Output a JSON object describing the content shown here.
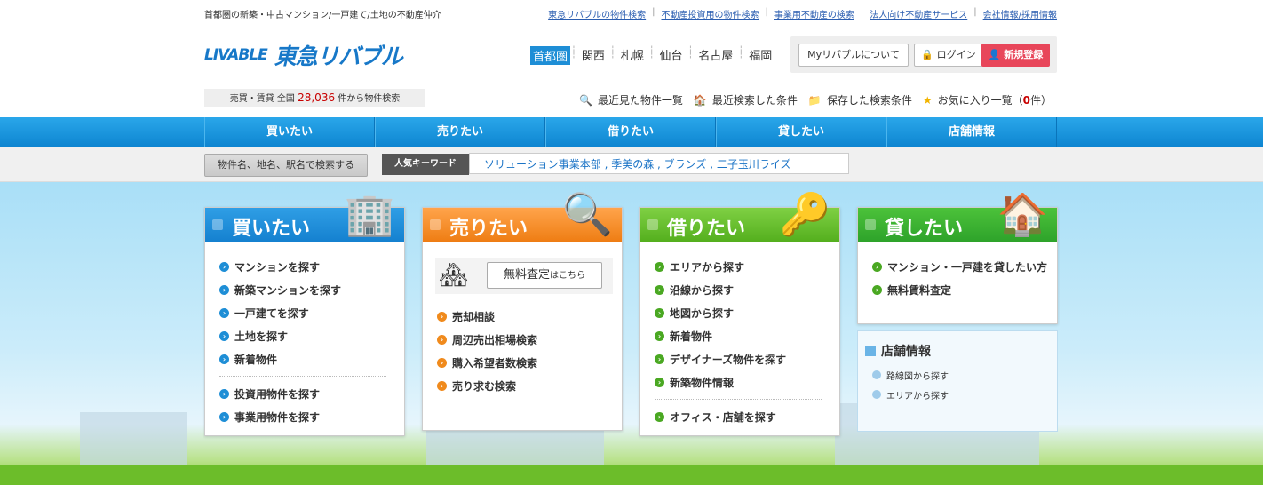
{
  "header": {
    "tagline": "首都圏の新築・中古マンション/一戸建て/土地の不動産仲介",
    "top_links": [
      "東急リバブルの物件検索",
      "不動産投資用の物件検索",
      "事業用不動産の検索",
      "法人向け不動産サービス",
      "会社情報/採用情報"
    ],
    "logo_mark": "LIVABLE",
    "logo_text": "東急リバブル",
    "regions": [
      "首都圏",
      "関西",
      "札幌",
      "仙台",
      "名古屋",
      "福岡"
    ],
    "active_region": "首都圏",
    "about_button": "Myリバブルについて",
    "login_button": "ログイン",
    "register_button": "新規登録"
  },
  "count": {
    "prefix": "売買・賃貸 全国",
    "number": "28,036",
    "suffix": "件から物件検索"
  },
  "quick_links": {
    "recent_viewed": "最近見た物件一覧",
    "recent_search": "最近検索した条件",
    "saved_search": "保存した検索条件",
    "favorites": "お気に入り一覧（",
    "favorites_count": "0",
    "favorites_suffix": "件）"
  },
  "nav": [
    "買いたい",
    "売りたい",
    "借りたい",
    "貸したい",
    "店舗情報"
  ],
  "search": {
    "button": "物件名、地名、駅名で検索する",
    "keyword_label": "人気キーワード",
    "keywords": "ソリューション事業本部 , 季美の森 , ブランズ , 二子玉川ライズ"
  },
  "cards": {
    "buy": {
      "title": "買いたい",
      "items": [
        "マンションを探す",
        "新築マンションを探す",
        "一戸建てを探す",
        "土地を探す",
        "新着物件"
      ],
      "items2": [
        "投資用物件を探す",
        "事業用物件を探す"
      ]
    },
    "sell": {
      "title": "売りたい",
      "appraise": "無料査定",
      "appraise_suffix": "はこちら",
      "items": [
        "売却相談",
        "周辺売出相場検索",
        "購入希望者数検索",
        "売り求む検索"
      ]
    },
    "rent": {
      "title": "借りたい",
      "items": [
        "エリアから探す",
        "沿線から探す",
        "地図から探す",
        "新着物件",
        "デザイナーズ物件を探す",
        "新築物件情報"
      ],
      "items2": [
        "オフィス・店舗を探す"
      ]
    },
    "lend": {
      "title": "貸したい",
      "items": [
        "マンション・一戸建を貸したい方",
        "無料賃料査定"
      ]
    },
    "store": {
      "title": "店舗情報",
      "items": [
        "路線図から探す",
        "エリアから探す"
      ]
    }
  },
  "colors": {
    "nav_blue": "#1e8ed6",
    "register_red": "#e8465a",
    "count_red": "#c80000",
    "buy": "#1480cf",
    "sell": "#ee7c12",
    "rent": "#53ae1d",
    "lend": "#2da22a"
  }
}
